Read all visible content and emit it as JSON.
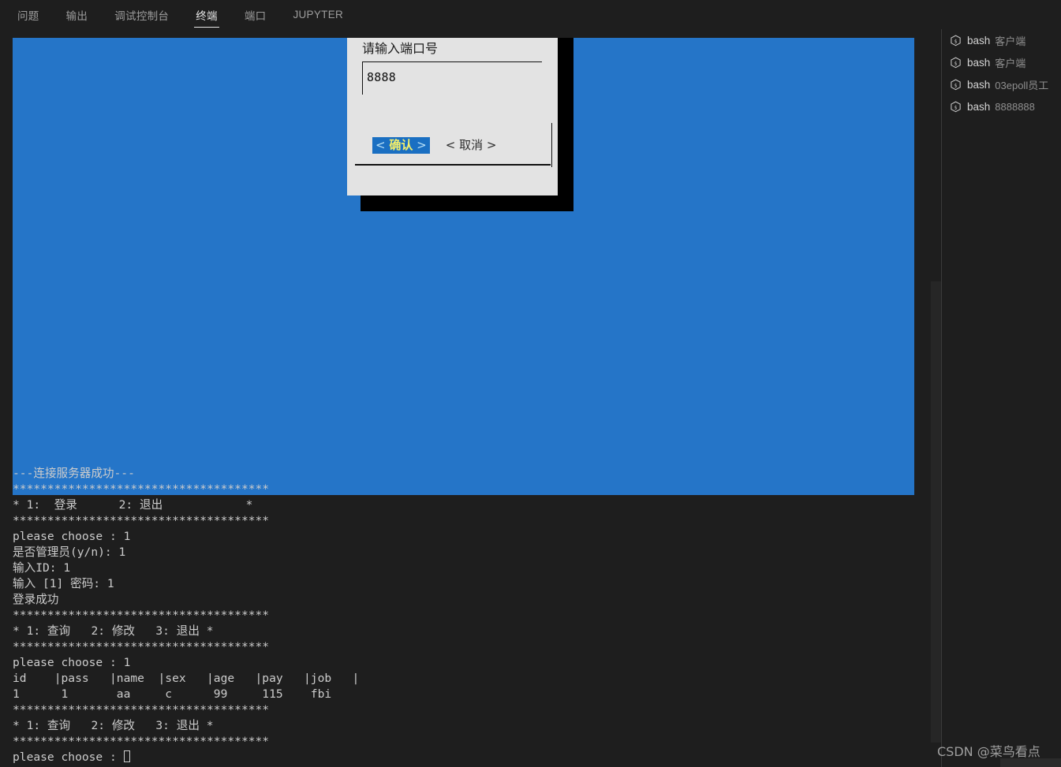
{
  "panel_tabs": [
    {
      "label": "问题",
      "active": false
    },
    {
      "label": "输出",
      "active": false
    },
    {
      "label": "调试控制台",
      "active": false
    },
    {
      "label": "终端",
      "active": true
    },
    {
      "label": "端口",
      "active": false
    },
    {
      "label": "JUPYTER",
      "active": false
    }
  ],
  "dialog": {
    "title": "请输入端口号",
    "input_value": "8888",
    "input_placeholder": "",
    "confirm": {
      "left_bracket": "<",
      "label": "确认",
      "right_bracket": ">"
    },
    "cancel": {
      "left_bracket": "<",
      "label": "取消",
      "right_bracket": ">"
    },
    "colors": {
      "dialog_bg": "#e3e3e3",
      "shadow": "#000000",
      "button_highlight_bg": "#1a6fc2",
      "button_label": "#f6f06a",
      "button_bracket": "#b7e0f7"
    }
  },
  "tui": {
    "background_color": "#2575c8"
  },
  "terminal_output": {
    "lines": [
      "---连接服务器成功---",
      "*************************************",
      "* 1:  登录      2: 退出            *",
      "*************************************",
      "please choose : 1",
      "是否管理员(y/n): 1",
      "输入ID: 1",
      "输入 [1] 密码: 1",
      "登录成功",
      "*************************************",
      "* 1: 查询   2: 修改   3: 退出 *",
      "*************************************",
      "please choose : 1",
      "id    |pass   |name  |sex   |age   |pay   |job   |",
      "1      1       aa     c      99     115    fbi",
      "*************************************",
      "* 1: 查询   2: 修改   3: 退出 *",
      "*************************************"
    ],
    "prompt_line": "please choose : ",
    "table": {
      "headers": [
        "id",
        "pass",
        "name",
        "sex",
        "age",
        "pay",
        "job"
      ],
      "rows": [
        [
          "1",
          "1",
          "aa",
          "c",
          "99",
          "115",
          "fbi"
        ]
      ]
    },
    "text_color": "#cccccc"
  },
  "terminal_list": {
    "items": [
      {
        "shell": "bash",
        "desc": "客户端"
      },
      {
        "shell": "bash",
        "desc": "客户端"
      },
      {
        "shell": "bash",
        "desc": "03epoll员工"
      },
      {
        "shell": "bash",
        "desc": "8888888"
      }
    ]
  },
  "watermark": {
    "text": "CSDN @菜鸟看点"
  }
}
